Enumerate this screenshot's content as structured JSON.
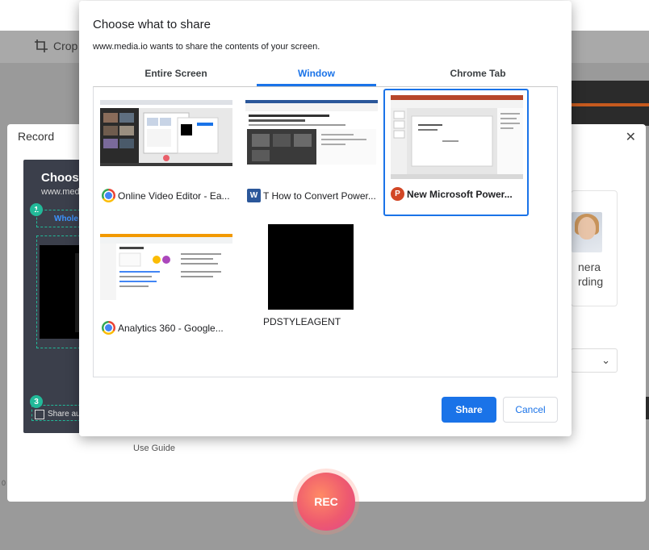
{
  "background": {
    "toolbar": {
      "crop_label": "Crop"
    },
    "record_panel": {
      "title": "Record",
      "preview_title": "Choose",
      "preview_url": "www.med",
      "tab_whole": "Whole",
      "share_audio_label": "Share au",
      "step_badges": [
        "1",
        "3"
      ],
      "use_guide": "Use Guide",
      "camera_line1": "nera",
      "camera_line2": "rding",
      "rec_label": "REC",
      "left_digit": "0"
    }
  },
  "dialog": {
    "title": "Choose what to share",
    "subtitle": "www.media.io wants to share the contents of your screen.",
    "tabs": [
      {
        "label": "Entire Screen",
        "active": false
      },
      {
        "label": "Window",
        "active": true
      },
      {
        "label": "Chrome Tab",
        "active": false
      }
    ],
    "windows": [
      {
        "label": "Online Video Editor - Ea...",
        "app_icon": "chrome-icon",
        "selected": false
      },
      {
        "label": "T How to Convert Power...",
        "app_icon": "word-icon",
        "selected": false
      },
      {
        "label": "New Microsoft Power...",
        "app_icon": "powerpoint-icon",
        "selected": true
      },
      {
        "label": "Analytics 360 - Google...",
        "app_icon": "chrome-icon",
        "selected": false
      },
      {
        "label": "PDSTYLEAGENT",
        "app_icon": "",
        "selected": false
      }
    ],
    "share_button": "Share",
    "cancel_button": "Cancel"
  },
  "colors": {
    "accent": "#1a73e8",
    "rec_gradient_start": "#ff8a65",
    "rec_gradient_end": "#e0468b",
    "step_badge": "#22b999"
  }
}
